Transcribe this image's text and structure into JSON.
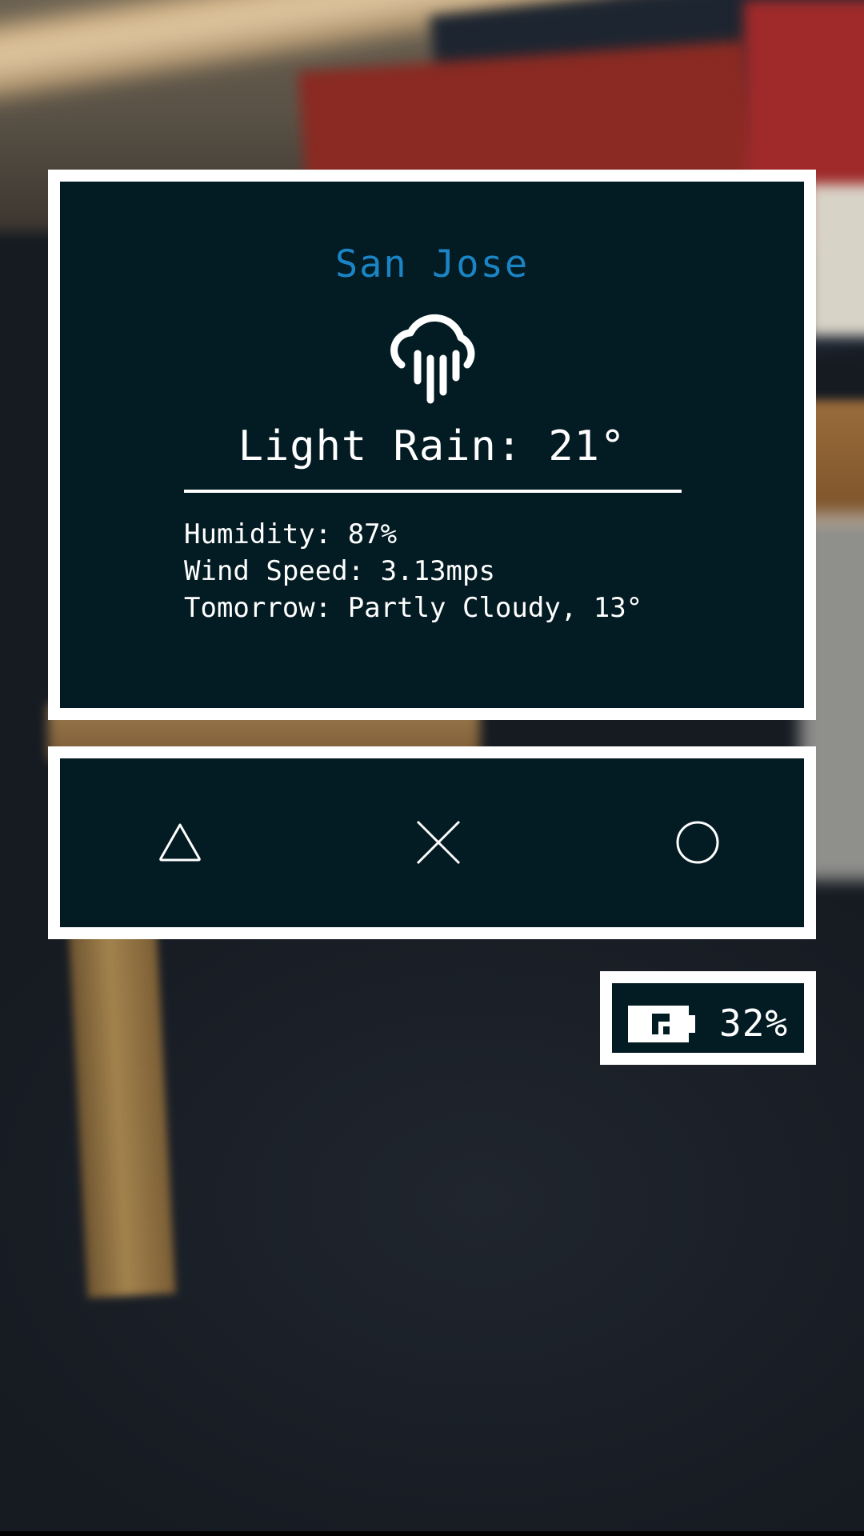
{
  "weather": {
    "city": "San Jose",
    "condition_line": "Light Rain: 21°",
    "humidity_line": "Humidity: 87%",
    "wind_line": "Wind Speed: 3.13mps",
    "tomorrow_line": "Tomorrow: Partly Cloudy, 13°",
    "icon": "cloud-rain-icon",
    "city_color": "#1a84c4"
  },
  "controls": {
    "buttons": [
      {
        "name": "triangle-button",
        "icon": "triangle-icon"
      },
      {
        "name": "cross-button",
        "icon": "cross-icon"
      },
      {
        "name": "circle-button",
        "icon": "circle-icon"
      }
    ]
  },
  "battery": {
    "icon": "battery-icon",
    "level_text": "32%",
    "level": 0.32
  },
  "colors": {
    "panel_background": "#031b22",
    "panel_border": "#ffffff",
    "text": "#ffffff"
  }
}
